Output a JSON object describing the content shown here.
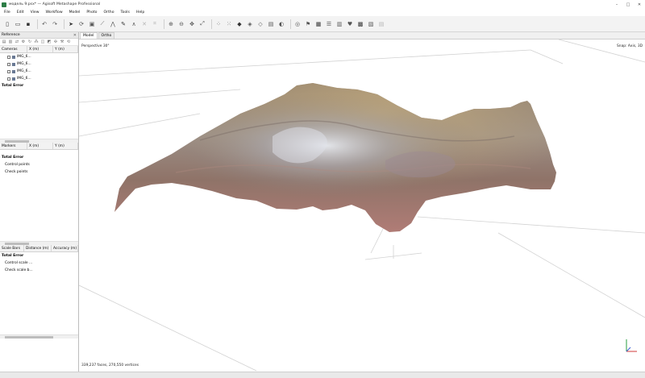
{
  "window": {
    "title": "модель 9.psx* — Agisoft Metashape Professional",
    "controls": [
      "–",
      "□",
      "✕"
    ]
  },
  "menu": [
    "File",
    "Edit",
    "View",
    "Workflow",
    "Model",
    "Photo",
    "Ortho",
    "Tools",
    "Help"
  ],
  "reference_panel": {
    "title": "Reference",
    "close": "✕",
    "cameras": {
      "headers": [
        "Cameras",
        "X (m)",
        "Y (m)"
      ],
      "items": [
        "IMG_6...",
        "IMG_6...",
        "IMG_6...",
        "IMG_6..."
      ],
      "total": "Total Error"
    },
    "markers": {
      "headers": [
        "Markers",
        "X (m)",
        "Y (m)"
      ],
      "total": "Total Error",
      "items": [
        "Control points",
        "Check points"
      ]
    },
    "scalebars": {
      "headers": [
        "Scale Bars",
        "Distance (m)",
        "Accuracy (m)"
      ],
      "total": "Total Error",
      "items": [
        "Control scale ...",
        "Check scale b..."
      ]
    }
  },
  "tabs": [
    "Model",
    "Ortho"
  ],
  "viewport": {
    "projection": "Perspective 30°",
    "snap": "Snap: Axis, 3D",
    "stats": "339,237 faces, 270,550 vertices"
  }
}
